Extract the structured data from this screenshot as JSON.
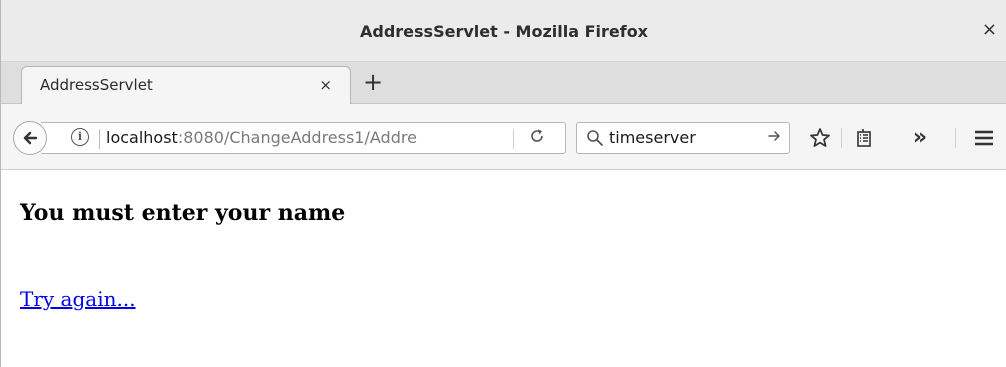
{
  "window": {
    "title": "AddressServlet - Mozilla Firefox",
    "close_glyph": "×"
  },
  "tabs": [
    {
      "label": "AddressServlet",
      "close_glyph": "×"
    }
  ],
  "new_tab_glyph": "+",
  "nav": {
    "url_host": "localhost",
    "url_rest": ":8080/ChangeAddress1/Addre",
    "search_value": "timeserver",
    "icons": [
      "back-arrow-icon",
      "info-icon",
      "reload-icon",
      "search-icon",
      "search-go-arrow-icon",
      "bookmark-star-icon",
      "reader-list-icon",
      "overflow-chevron-icon",
      "hamburger-menu-icon"
    ]
  },
  "page": {
    "heading": "You must enter your name",
    "link_text": "Try again..."
  },
  "colors": {
    "link": "#0000ee",
    "chrome_bg": "#ebebeb",
    "toolbar_bg": "#f5f5f5"
  }
}
